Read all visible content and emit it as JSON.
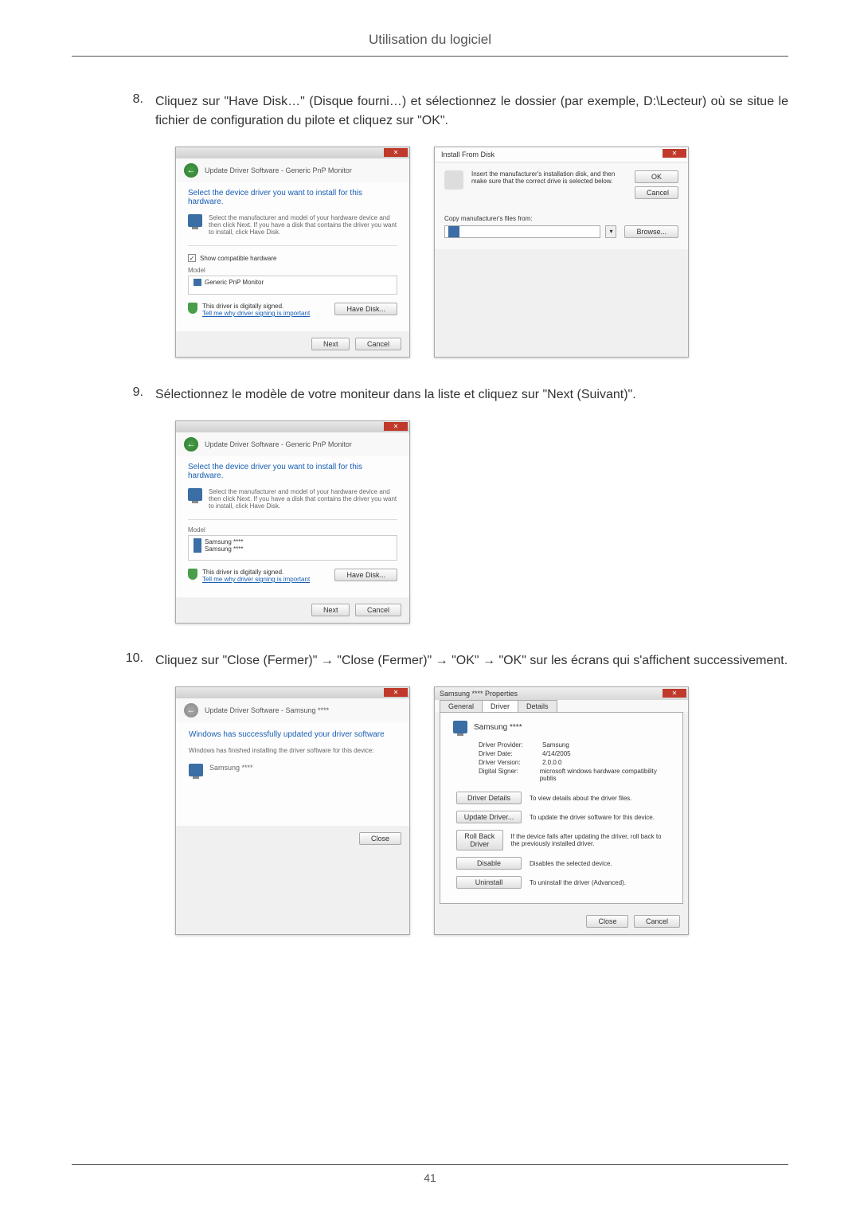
{
  "header": {
    "title": "Utilisation du logiciel"
  },
  "steps": {
    "s8": {
      "num": "8.",
      "text": "Cliquez sur \"Have Disk…\" (Disque fourni…) et sélectionnez le dossier (par exemple, D:\\Lecteur) où se situe le fichier de configuration du pilote et cliquez sur \"OK\"."
    },
    "s9": {
      "num": "9.",
      "text": "Sélectionnez le modèle de votre moniteur dans la liste et cliquez sur \"Next (Suivant)\"."
    },
    "s10": {
      "num": "10.",
      "text": "Cliquez sur \"Close (Fermer)\" → \"Close (Fermer)\" → \"OK\" → \"OK\" sur les écrans qui s'affichent successivement."
    }
  },
  "dialogs": {
    "update1": {
      "nav_title": "Update Driver Software - Generic PnP Monitor",
      "section_title": "Select the device driver you want to install for this hardware.",
      "instruction": "Select the manufacturer and model of your hardware device and then click Next. If you have a disk that contains the driver you want to install, click Have Disk.",
      "show_compatible": "Show compatible hardware",
      "model_label": "Model",
      "model_item": "Generic PnP Monitor",
      "signed_text": "This driver is digitally signed.",
      "tell_me_link": "Tell me why driver signing is important",
      "have_disk_btn": "Have Disk...",
      "next_btn": "Next",
      "cancel_btn": "Cancel"
    },
    "install_disk": {
      "title": "Install From Disk",
      "instruction": "Insert the manufacturer's installation disk, and then make sure that the correct drive is selected below.",
      "ok_btn": "OK",
      "cancel_btn": "Cancel",
      "copy_label": "Copy manufacturer's files from:",
      "browse_btn": "Browse..."
    },
    "update2": {
      "nav_title": "Update Driver Software - Generic PnP Monitor",
      "section_title": "Select the device driver you want to install for this hardware.",
      "instruction": "Select the manufacturer and model of your hardware device and then click Next. If you have a disk that contains the driver you want to install, click Have Disk.",
      "model_label": "Model",
      "model_item1": "Samsung ****",
      "model_item2": "Samsung ****",
      "signed_text": "This driver is digitally signed.",
      "tell_me_link": "Tell me why driver signing is important",
      "have_disk_btn": "Have Disk...",
      "next_btn": "Next",
      "cancel_btn": "Cancel"
    },
    "success": {
      "nav_title": "Update Driver Software - Samsung ****",
      "section_title": "Windows has successfully updated your driver software",
      "subtext": "Windows has finished installing the driver software for this device:",
      "device_name": "Samsung ****",
      "close_btn": "Close"
    },
    "props": {
      "title": "Samsung **** Properties",
      "tabs": {
        "general": "General",
        "driver": "Driver",
        "details": "Details"
      },
      "device_name": "Samsung ****",
      "provider_label": "Driver Provider:",
      "provider_value": "Samsung",
      "date_label": "Driver Date:",
      "date_value": "4/14/2005",
      "version_label": "Driver Version:",
      "version_value": "2.0.0.0",
      "signer_label": "Digital Signer:",
      "signer_value": "microsoft windows hardware compatibility publis",
      "buttons": {
        "details": {
          "label": "Driver Details",
          "desc": "To view details about the driver files."
        },
        "update": {
          "label": "Update Driver...",
          "desc": "To update the driver software for this device."
        },
        "rollback": {
          "label": "Roll Back Driver",
          "desc": "If the device fails after updating the driver, roll back to the previously installed driver."
        },
        "disable": {
          "label": "Disable",
          "desc": "Disables the selected device."
        },
        "uninstall": {
          "label": "Uninstall",
          "desc": "To uninstall the driver (Advanced)."
        }
      },
      "close_btn": "Close",
      "cancel_btn": "Cancel"
    }
  },
  "footer": {
    "page_num": "41"
  }
}
